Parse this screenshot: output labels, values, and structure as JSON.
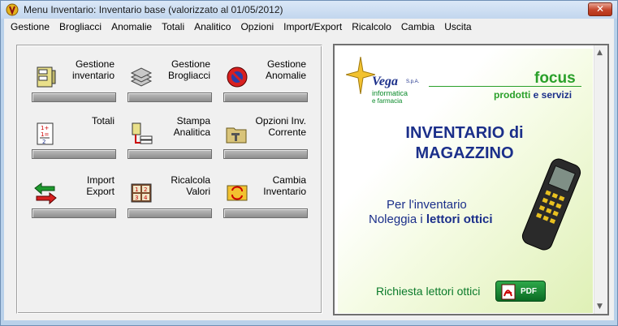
{
  "window": {
    "title": "Menu Inventario: Inventario base (valorizzato al 01/05/2012)",
    "close_glyph": "✕"
  },
  "menubar": {
    "items": [
      "Gestione",
      "Brogliacci",
      "Anomalie",
      "Totali",
      "Analitico",
      "Opzioni",
      "Import/Export",
      "Ricalcolo",
      "Cambia",
      "Uscita"
    ]
  },
  "tiles": [
    {
      "label": "Gestione\ninventario",
      "icon": "inventory-folder-icon"
    },
    {
      "label": "Gestione\nBrogliacci",
      "icon": "stack-sheets-icon"
    },
    {
      "label": "Gestione\nAnomalie",
      "icon": "no-entry-icon"
    },
    {
      "label": "Totali",
      "icon": "sum-sheet-icon"
    },
    {
      "label": "Stampa\nAnalitica",
      "icon": "print-list-icon"
    },
    {
      "label": "Opzioni Inv.\nCorrente",
      "icon": "tools-folder-icon"
    },
    {
      "label": "Import\nExport",
      "icon": "exchange-arrows-icon"
    },
    {
      "label": "Ricalcola\nValori",
      "icon": "calculator-grid-icon"
    },
    {
      "label": "Cambia\nInventario",
      "icon": "swap-window-icon"
    }
  ],
  "ad": {
    "brand": "Vega",
    "brand_suffix": "S.p.A.",
    "brand_sub1": "informatica",
    "brand_sub2": "e farmacia",
    "focus": "focus",
    "focus_sub_a": "prodotti",
    "focus_sub_b": " e servizi",
    "title": "INVENTARIO di MAGAZZINO",
    "line1": "Per l'inventario",
    "line2_a": "Noleggia i ",
    "line2_b": "lettori ottici",
    "request": "Richiesta lettori ottici",
    "pdf_label": "PDF"
  },
  "colors": {
    "brand_blue": "#1b2f8a",
    "brand_green": "#2aa02a",
    "window_frame": "#b9d1ea",
    "close_red": "#c4442a"
  }
}
